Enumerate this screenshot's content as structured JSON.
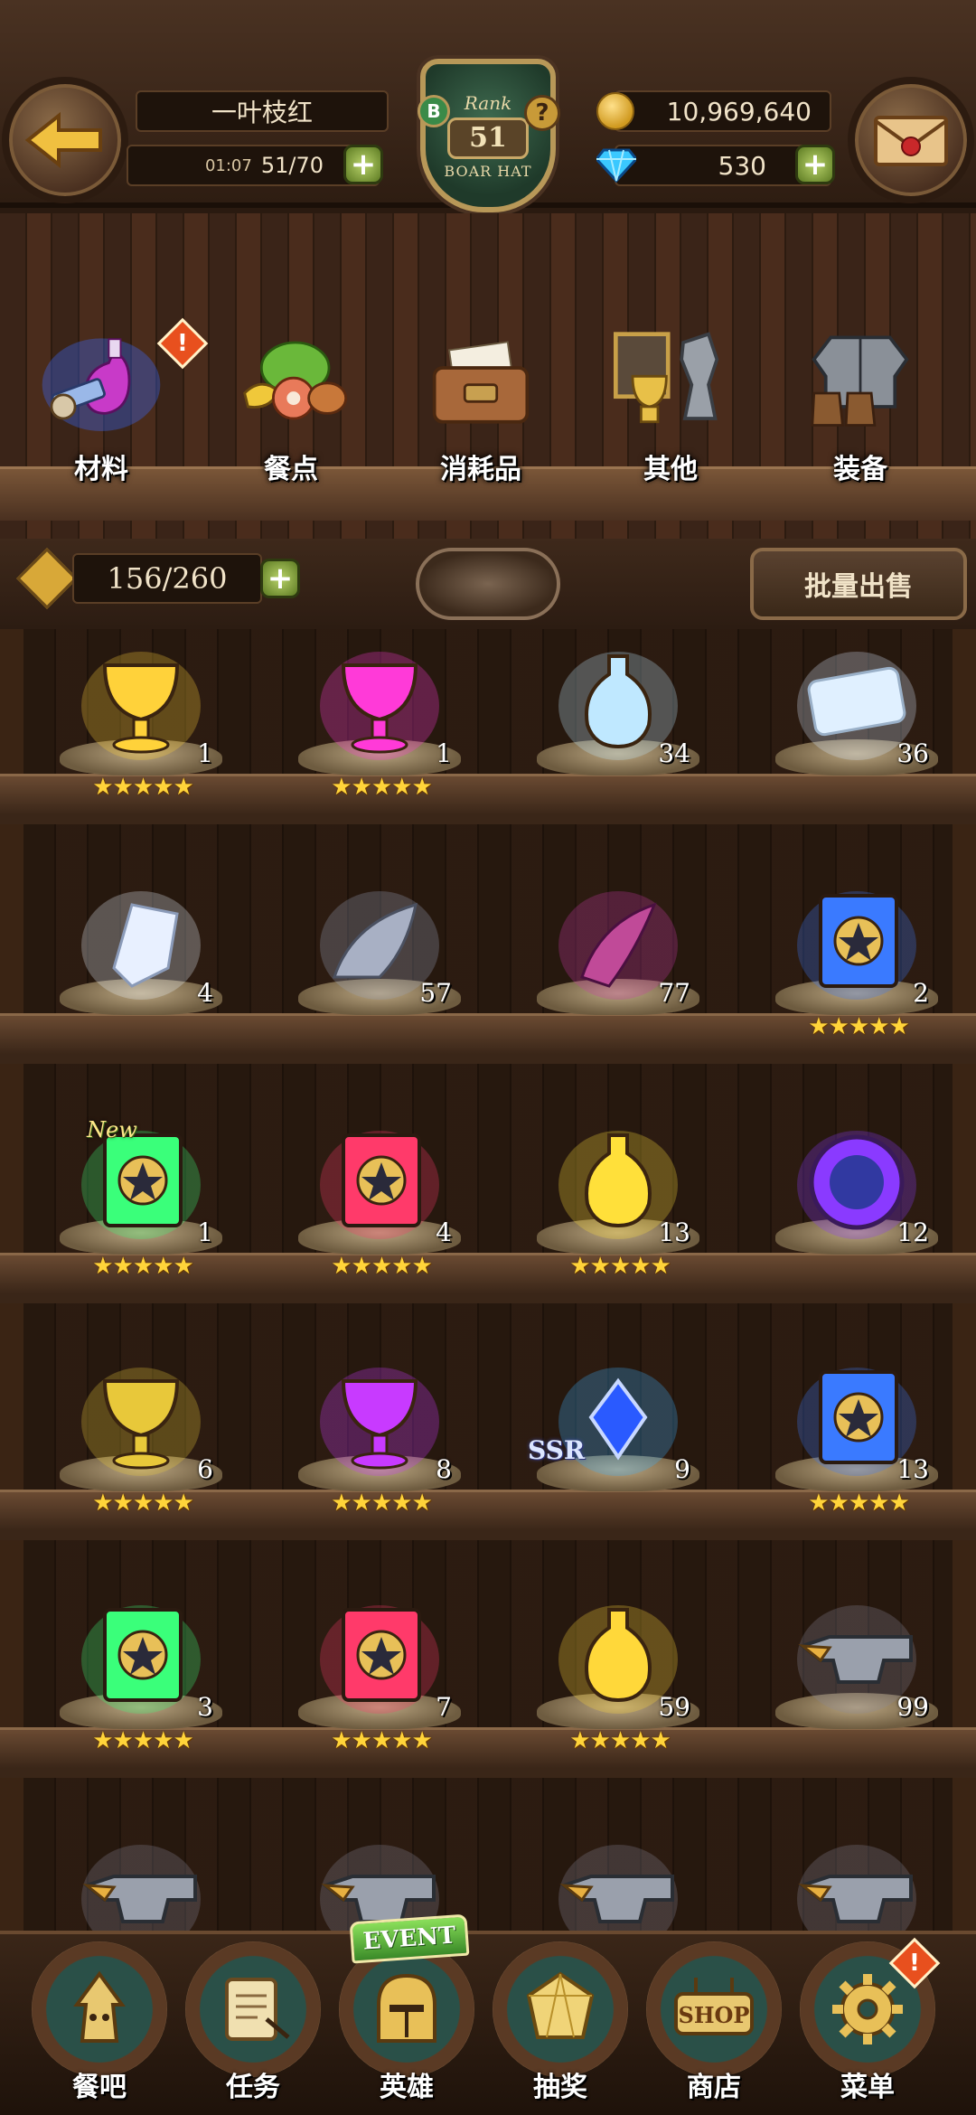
{
  "header": {
    "player_name": "一叶枝红",
    "stamina_timer": "01:07",
    "stamina": "51/70",
    "rank_label": "Rank",
    "rank_value": "51",
    "rank_title": "BOAR HAT",
    "rank_grade": "B",
    "gold": "10,969,640",
    "gems": "530"
  },
  "categories": [
    {
      "label": "材料",
      "icon": "materials-icon",
      "alert": true
    },
    {
      "label": "餐点",
      "icon": "food-icon",
      "alert": false
    },
    {
      "label": "消耗品",
      "icon": "consumables-icon",
      "alert": false
    },
    {
      "label": "其他",
      "icon": "trophy-icon",
      "alert": false
    },
    {
      "label": "装备",
      "icon": "armor-icon",
      "alert": false
    }
  ],
  "capacity": "156/260",
  "sell_button": "批量出售",
  "items": [
    {
      "icon": "gold-chalice-icon",
      "count": "1",
      "stars": "★★★★★",
      "glow": "#ffd23a"
    },
    {
      "icon": "purple-chalice-icon",
      "count": "1",
      "stars": "★★★★★",
      "glow": "#ff3ad8"
    },
    {
      "icon": "potion-bottle-icon",
      "count": "34",
      "stars": "",
      "glow": "#bfe8ff"
    },
    {
      "icon": "crystal-scroll-icon",
      "count": "36",
      "stars": "",
      "glow": "#d8e8ff"
    },
    {
      "icon": "crystal-shard-icon",
      "count": "4",
      "stars": "",
      "glow": "#e8f4ff"
    },
    {
      "icon": "wing-feather-icon",
      "count": "57",
      "stars": "",
      "glow": "#9aa4c0"
    },
    {
      "icon": "demon-horn-icon",
      "count": "77",
      "stars": "",
      "glow": "#c83aa8"
    },
    {
      "icon": "blue-spellbook-icon",
      "count": "2",
      "stars": "★★★★★",
      "glow": "#3a7aff"
    },
    {
      "icon": "green-spellbook-icon",
      "count": "1",
      "stars": "★★★★★",
      "glow": "#3aff7a",
      "new": "New"
    },
    {
      "icon": "red-spellbook-icon",
      "count": "4",
      "stars": "★★★★★",
      "glow": "#ff3a6a"
    },
    {
      "icon": "gold-elixir-icon",
      "count": "13",
      "stars": "★★★★★",
      "glow": "#ffe03a"
    },
    {
      "icon": "cosmic-orb-icon",
      "count": "12",
      "stars": "",
      "glow": "#8a3aff"
    },
    {
      "icon": "yellow-goblet-icon",
      "count": "6",
      "stars": "★★★★★",
      "glow": "#e8c83a"
    },
    {
      "icon": "violet-goblet-icon",
      "count": "8",
      "stars": "★★★★★",
      "glow": "#c83aff"
    },
    {
      "icon": "sapphire-pendant-icon",
      "count": "9",
      "stars": "",
      "glow": "#3ab0ff",
      "ssr": "SSR"
    },
    {
      "icon": "blue-spellbook-icon",
      "count": "13",
      "stars": "★★★★★",
      "glow": "#3a7aff"
    },
    {
      "icon": "green-spellbook-icon",
      "count": "3",
      "stars": "★★★★★",
      "glow": "#3aff7a"
    },
    {
      "icon": "red-spellbook-icon",
      "count": "7",
      "stars": "★★★★★",
      "glow": "#ff3a6a"
    },
    {
      "icon": "yellow-potion-icon",
      "count": "59",
      "stars": "★★★★★",
      "glow": "#ffd83a"
    },
    {
      "icon": "anvil-icon",
      "count": "99",
      "stars": "",
      "glow": "#8a8a9a"
    },
    {
      "icon": "anvil-icon",
      "count": "",
      "stars": "",
      "glow": "#8a8a9a"
    },
    {
      "icon": "anvil-icon",
      "count": "",
      "stars": "",
      "glow": "#8a8a9a"
    },
    {
      "icon": "anvil-icon",
      "count": "",
      "stars": "",
      "glow": "#8a8a9a"
    },
    {
      "icon": "anvil-icon",
      "count": "",
      "stars": "",
      "glow": "#8a8a9a"
    }
  ],
  "bottom_nav": [
    {
      "label": "餐吧",
      "icon": "tavern-icon"
    },
    {
      "label": "任务",
      "icon": "quest-scroll-icon"
    },
    {
      "label": "英雄",
      "icon": "hero-helmet-icon",
      "tag": "EVENT"
    },
    {
      "label": "抽奖",
      "icon": "gacha-gem-icon"
    },
    {
      "label": "商店",
      "icon": "shop-sign-icon",
      "sign": "SHOP"
    },
    {
      "label": "菜单",
      "icon": "menu-gear-icon",
      "alert": true
    }
  ],
  "colors": {
    "accent_green": "#5c7a22",
    "alert_orange": "#e8501e",
    "star_gold": "#ffd43a"
  }
}
